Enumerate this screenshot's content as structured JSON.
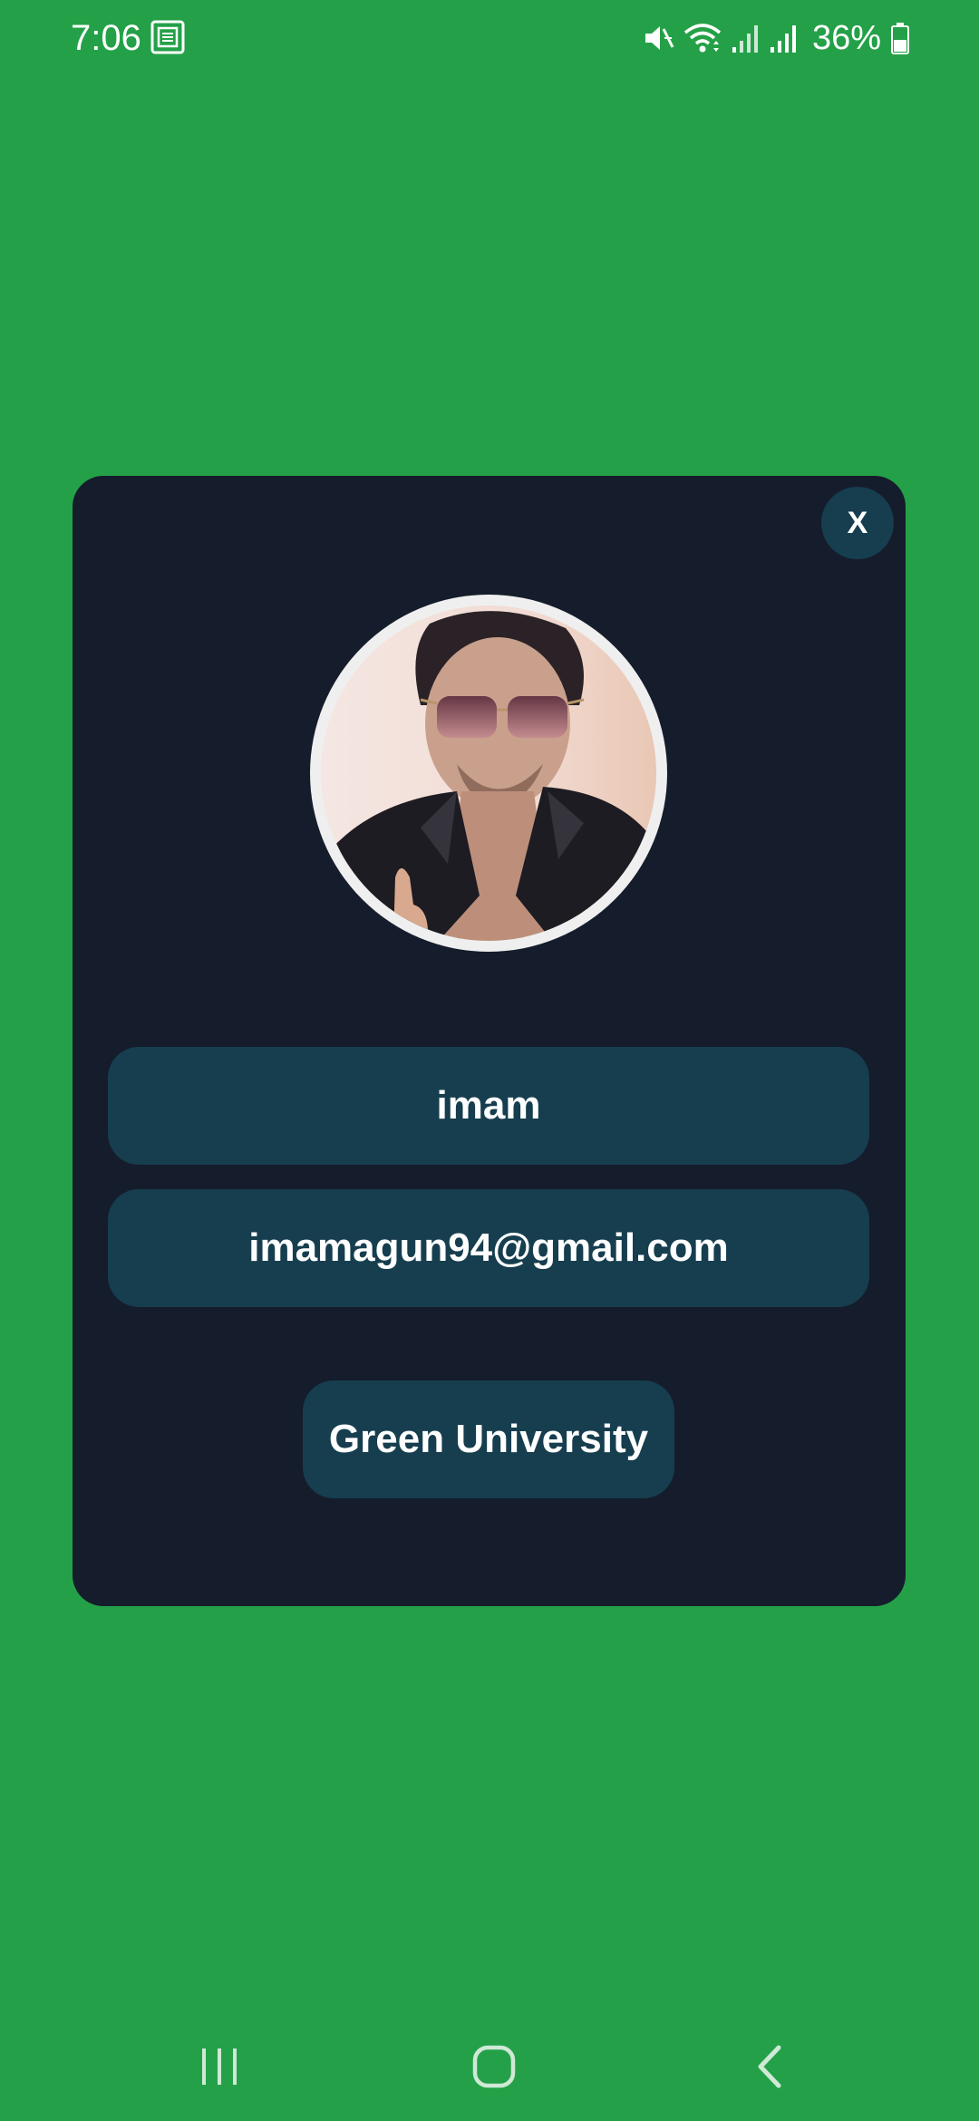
{
  "status_bar": {
    "time": "7:06",
    "battery": "36%",
    "icons": [
      "notification-icon",
      "mute-icon",
      "wifi-icon",
      "signal-icon",
      "signal-icon",
      "battery-icon"
    ]
  },
  "dialog": {
    "close_label": "X",
    "avatar": "profile-photo",
    "name": "imam",
    "email": "imamagun94@gmail.com",
    "university": "Green University"
  },
  "nav_bar": {
    "icons": [
      "recents-icon",
      "home-icon",
      "back-icon"
    ]
  },
  "colors": {
    "background": "#24a148",
    "card": "#151c2b",
    "field": "#163e4f",
    "text": "#ffffff"
  }
}
